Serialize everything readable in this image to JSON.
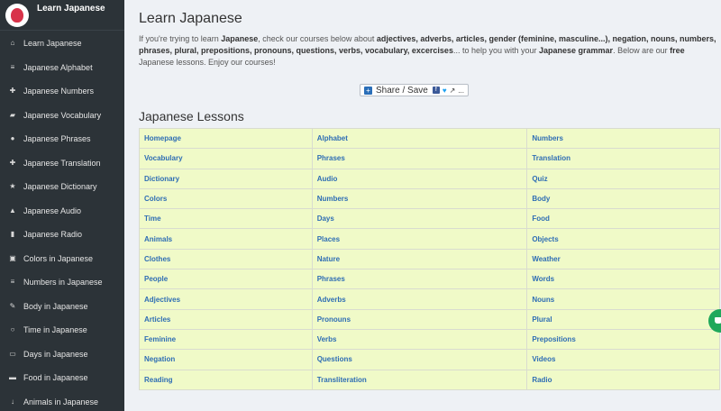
{
  "sidebar": {
    "brand": "Learn Japanese",
    "items": [
      {
        "label": "Learn Japanese",
        "icon": "home-icon",
        "glyph": "⌂"
      },
      {
        "label": "Japanese Alphabet",
        "icon": "list-icon",
        "glyph": "≡"
      },
      {
        "label": "Japanese Numbers",
        "icon": "plus-icon",
        "glyph": "✚"
      },
      {
        "label": "Japanese Vocabulary",
        "icon": "book-icon",
        "glyph": "▰"
      },
      {
        "label": "Japanese Phrases",
        "icon": "globe-icon",
        "glyph": "●"
      },
      {
        "label": "Japanese Translation",
        "icon": "plus-icon",
        "glyph": "✚"
      },
      {
        "label": "Japanese Dictionary",
        "icon": "star-icon",
        "glyph": "★"
      },
      {
        "label": "Japanese Audio",
        "icon": "thumbs-up-icon",
        "glyph": "▲"
      },
      {
        "label": "Japanese Radio",
        "icon": "file-icon",
        "glyph": "▮"
      },
      {
        "label": "Colors in Japanese",
        "icon": "columns-icon",
        "glyph": "▣"
      },
      {
        "label": "Numbers in Japanese",
        "icon": "list-icon",
        "glyph": "≡"
      },
      {
        "label": "Body in Japanese",
        "icon": "pin-icon",
        "glyph": "✎"
      },
      {
        "label": "Time in Japanese",
        "icon": "clock-icon",
        "glyph": "○"
      },
      {
        "label": "Days in Japanese",
        "icon": "inbox-icon",
        "glyph": "▭"
      },
      {
        "label": "Food in Japanese",
        "icon": "folder-icon",
        "glyph": "▬"
      },
      {
        "label": "Animals in Japanese",
        "icon": "sort-icon",
        "glyph": "↓"
      }
    ]
  },
  "main": {
    "title": "Learn Japanese",
    "intro": {
      "t1": "If you're trying to learn ",
      "b1": "Japanese",
      "t2": ", check our courses below about ",
      "b2": "adjectives, adverbs, articles, gender (feminine, masculine...), negation, nouns, numbers, phrases, plural, prepositions, pronouns, questions, verbs, vocabulary, excercises",
      "t3": "... to help you with your ",
      "b3": "Japanese grammar",
      "t4": ". Below are our ",
      "b4": "free",
      "t5": " Japanese lessons. Enjoy our courses!"
    },
    "share": {
      "label": "Share / Save",
      "more": "..."
    },
    "lessons_title": "Japanese Lessons",
    "lessons": [
      [
        "Homepage",
        "Alphabet",
        "Numbers"
      ],
      [
        "Vocabulary",
        "Phrases",
        "Translation"
      ],
      [
        "Dictionary",
        "Audio",
        "Quiz"
      ],
      [
        "Colors",
        "Numbers",
        "Body"
      ],
      [
        "Time",
        "Days",
        "Food"
      ],
      [
        "Animals",
        "Places",
        "Objects"
      ],
      [
        "Clothes",
        "Nature",
        "Weather"
      ],
      [
        "People",
        "Phrases",
        "Words"
      ],
      [
        "Adjectives",
        "Adverbs",
        "Nouns"
      ],
      [
        "Articles",
        "Pronouns",
        "Plural"
      ],
      [
        "Feminine",
        "Verbs",
        "Prepositions"
      ],
      [
        "Negation",
        "Questions",
        "Videos"
      ],
      [
        "Reading",
        "Transliteration",
        "Radio"
      ]
    ]
  },
  "colors": {
    "sidebar_bg": "#2c3338",
    "page_bg": "#eef1f5",
    "table_bg": "#f0fac8",
    "link": "#2e6db4",
    "chat_bubble": "#1fa85b"
  }
}
